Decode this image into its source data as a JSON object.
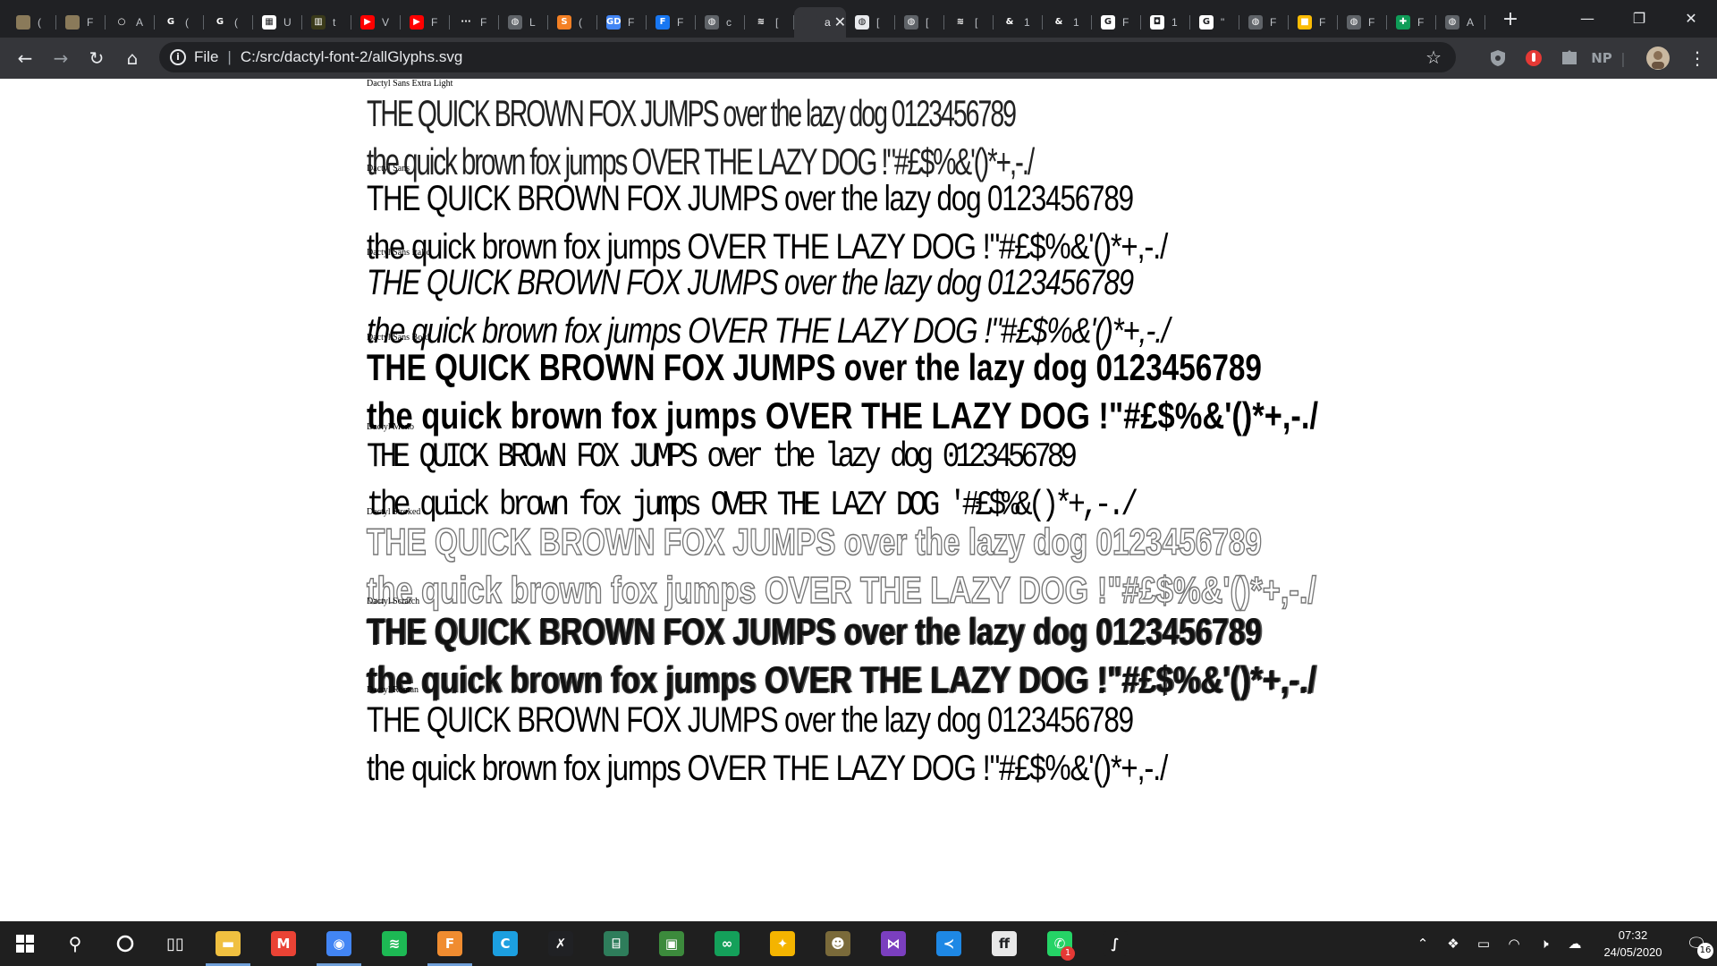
{
  "browser": {
    "tabs": [
      {
        "icon": "image-thumbnail-icon",
        "color": "#8a7a5a",
        "glyph": "",
        "label": "("
      },
      {
        "icon": "image-thumbnail-icon",
        "color": "#8a7a5a",
        "glyph": "",
        "label": "F"
      },
      {
        "icon": "github-icon",
        "color": "#202124",
        "glyph": "○",
        "label": "A"
      },
      {
        "icon": "google-icon",
        "color": "#202124",
        "glyph": "G",
        "label": "("
      },
      {
        "icon": "google-icon",
        "color": "#202124",
        "glyph": "G",
        "label": "("
      },
      {
        "icon": "doc-icon",
        "color": "#ffffff",
        "glyph": "▦",
        "label": "U"
      },
      {
        "icon": "doc-icon",
        "color": "#3a3a1a",
        "glyph": "▥",
        "label": "t"
      },
      {
        "icon": "youtube-icon",
        "color": "#ff0000",
        "glyph": "▶",
        "label": "V"
      },
      {
        "icon": "youtube-icon",
        "color": "#ff0000",
        "glyph": "▶",
        "label": "F"
      },
      {
        "icon": "dots-icon",
        "color": "#202124",
        "glyph": "···",
        "label": "F"
      },
      {
        "icon": "globe-icon",
        "color": "#5f6368",
        "glyph": "◍",
        "label": "L"
      },
      {
        "icon": "stackoverflow-icon",
        "color": "#f48024",
        "glyph": "S",
        "label": "("
      },
      {
        "icon": "gd-icon",
        "color": "#4285f4",
        "glyph": "GD",
        "label": "F"
      },
      {
        "icon": "facebook-icon",
        "color": "#1877f2",
        "glyph": "F",
        "label": "F"
      },
      {
        "icon": "globe-icon",
        "color": "#5f6368",
        "glyph": "◍",
        "label": "c"
      },
      {
        "icon": "flutter-icon",
        "color": "#202124",
        "glyph": "≋",
        "label": "["
      },
      {
        "icon": "svg-file-icon",
        "color": "#35363a",
        "glyph": "",
        "label": "al",
        "active": true
      },
      {
        "icon": "globe-icon",
        "color": "#e8eaed",
        "glyph": "◍",
        "label": "["
      },
      {
        "icon": "globe-icon",
        "color": "#5f6368",
        "glyph": "◍",
        "label": "["
      },
      {
        "icon": "flutter-icon",
        "color": "#202124",
        "glyph": "≋",
        "label": "["
      },
      {
        "icon": "ampersand-icon",
        "color": "#202124",
        "glyph": "&",
        "label": "1"
      },
      {
        "icon": "ampersand-icon",
        "color": "#202124",
        "glyph": "&",
        "label": "1"
      },
      {
        "icon": "google-icon",
        "color": "#ffffff",
        "glyph": "G",
        "label": "F"
      },
      {
        "icon": "bookmark-icon",
        "color": "#ffffff",
        "glyph": "◘",
        "label": "1"
      },
      {
        "icon": "google-icon",
        "color": "#ffffff",
        "glyph": "G",
        "label": "\""
      },
      {
        "icon": "globe-icon",
        "color": "#5f6368",
        "glyph": "◍",
        "label": "F"
      },
      {
        "icon": "slides-icon",
        "color": "#fbbc04",
        "glyph": "■",
        "label": "F"
      },
      {
        "icon": "globe-icon",
        "color": "#5f6368",
        "glyph": "◍",
        "label": "F"
      },
      {
        "icon": "plus-box-icon",
        "color": "#0f9d58",
        "glyph": "✚",
        "label": "F"
      },
      {
        "icon": "globe-icon",
        "color": "#5f6368",
        "glyph": "◍",
        "label": "A"
      }
    ],
    "new_tab": "+",
    "window": {
      "minimize": "—",
      "restore": "❐",
      "close": "✕"
    },
    "nav": {
      "back": "←",
      "forward": "→",
      "reload": "↻",
      "home": "⌂"
    },
    "address": {
      "scheme_label": "File",
      "url": "C:/src/dactyl-font-2/allGlyphs.svg",
      "info": "i",
      "star": "☆"
    },
    "extensions": {
      "profile_label": "NP"
    }
  },
  "page": {
    "fonts": [
      {
        "key": "light",
        "name": "Dactyl Sans Extra Light",
        "line1": "THE QUICK BROWN FOX JUMPS over the lazy dog 0123456789",
        "line2": "the quick brown fox  jumps OVER THE LAZY DOG !\"#£$%&'()*+,-./"
      },
      {
        "key": "regular",
        "name": "Dactyl Sans",
        "line1": "THE QUICK BROWN FOX JUMPS over the lazy dog 0123456789",
        "line2": "the quick brown fox  jumps OVER THE LAZY DOG !\"#£$%&'()*+,-./"
      },
      {
        "key": "italic",
        "name": "Dactyl Sans Italic",
        "line1": "THE QUICK BROWN FOX JUMPS over the lazy dog 0123456789",
        "line2": "the quick brown fox  jumps OVER THE LAZY DOG !\"#£$%&'()*+,-./"
      },
      {
        "key": "bold",
        "name": "Dactyl Sans Bold",
        "line1": "THE QUICK BROWN FOX JUMPS over the lazy dog 0123456789",
        "line2": "the quick brown fox  jumps OVER THE LAZY DOG !\"#£$%&'()*+,-./"
      },
      {
        "key": "mono",
        "name": "Dactyl Mono",
        "line1": "THE QUICK BROWN FOX JUMPS over the lazy dog 0123456789",
        "line2": "the quick brown fox  jumps OVER THE LAZY DOG  '#£$%&()*+,-./"
      },
      {
        "key": "stroked",
        "name": "Dactyl Stroked",
        "line1": "THE QUICK BROWN FOX JUMPS over the lazy dog 0123456789",
        "line2": "the quick brown fox  jumps OVER THE LAZY DOG !\"#£$%&'()*+,-./"
      },
      {
        "key": "scratch",
        "name": "Dactyl Scratch",
        "line1": "THE QUICK BROWN FOX JUMPS over the lazy dog 0123456789",
        "line2": "the quick brown fox  jumps OVER THE LAZY DOG !\"#£$%&'()*+,-./"
      },
      {
        "key": "roman",
        "name": "Dactyl Roman",
        "line1": "THE QUICK BROWN FOX JUMPS over the lazy dog 0123456789",
        "line2": "the quick brown fox  jumps OVER THE LAZY DOG !\"#£$%&'()*+,-./"
      }
    ]
  },
  "taskbar": {
    "apps": [
      {
        "name": "file-explorer",
        "icon": "folder-icon",
        "color": "#f0c040",
        "glyph": "▬",
        "running": true
      },
      {
        "name": "gmail",
        "icon": "gmail-icon",
        "color": "#ea4335",
        "glyph": "M",
        "running": false
      },
      {
        "name": "chrome",
        "icon": "chrome-icon",
        "color": "#4285f4",
        "glyph": "◉",
        "running": true
      },
      {
        "name": "spotify",
        "icon": "spotify-icon",
        "color": "#1db954",
        "glyph": "≋",
        "running": false
      },
      {
        "name": "fontforge",
        "icon": "font-file-icon",
        "color": "#f08c30",
        "glyph": "F",
        "running": true
      },
      {
        "name": "carbonite",
        "icon": "c-icon",
        "color": "#1c9fe0",
        "glyph": "C",
        "running": false
      },
      {
        "name": "xcode-like",
        "icon": "tools-icon",
        "color": "#202124",
        "glyph": "✗",
        "running": false
      },
      {
        "name": "terminal",
        "icon": "terminal-icon",
        "color": "#2e7d5b",
        "glyph": "⌸",
        "running": false
      },
      {
        "name": "photo-app",
        "icon": "photo-icon",
        "color": "#3c8a3c",
        "glyph": "▣",
        "running": false
      },
      {
        "name": "glasses-app",
        "icon": "glasses-icon",
        "color": "#14a05a",
        "glyph": "∞",
        "running": false
      },
      {
        "name": "ideas-app",
        "icon": "lightbulb-icon",
        "color": "#f4b400",
        "glyph": "✦",
        "running": false
      },
      {
        "name": "gimp",
        "icon": "gimp-icon",
        "color": "#7a6a3a",
        "glyph": "☻",
        "running": false
      },
      {
        "name": "visual-studio",
        "icon": "visual-studio-icon",
        "color": "#7b3fbf",
        "glyph": "⋈",
        "running": false
      },
      {
        "name": "vscode",
        "icon": "vscode-icon",
        "color": "#1e88e5",
        "glyph": "≺",
        "running": false
      },
      {
        "name": "fontforge-round",
        "icon": "ff-icon",
        "color": "#e8e8e8",
        "glyph": "ff",
        "running": false
      },
      {
        "name": "whatsapp",
        "icon": "whatsapp-icon",
        "color": "#25d366",
        "glyph": "✆",
        "running": false,
        "badge": "1"
      },
      {
        "name": "font-tool",
        "icon": "script-s-icon",
        "color": "#1f1f1f",
        "glyph": "∫",
        "running": false
      }
    ],
    "clock": {
      "time": "07:32",
      "date": "24/05/2020"
    },
    "notifications_badge": "16"
  }
}
